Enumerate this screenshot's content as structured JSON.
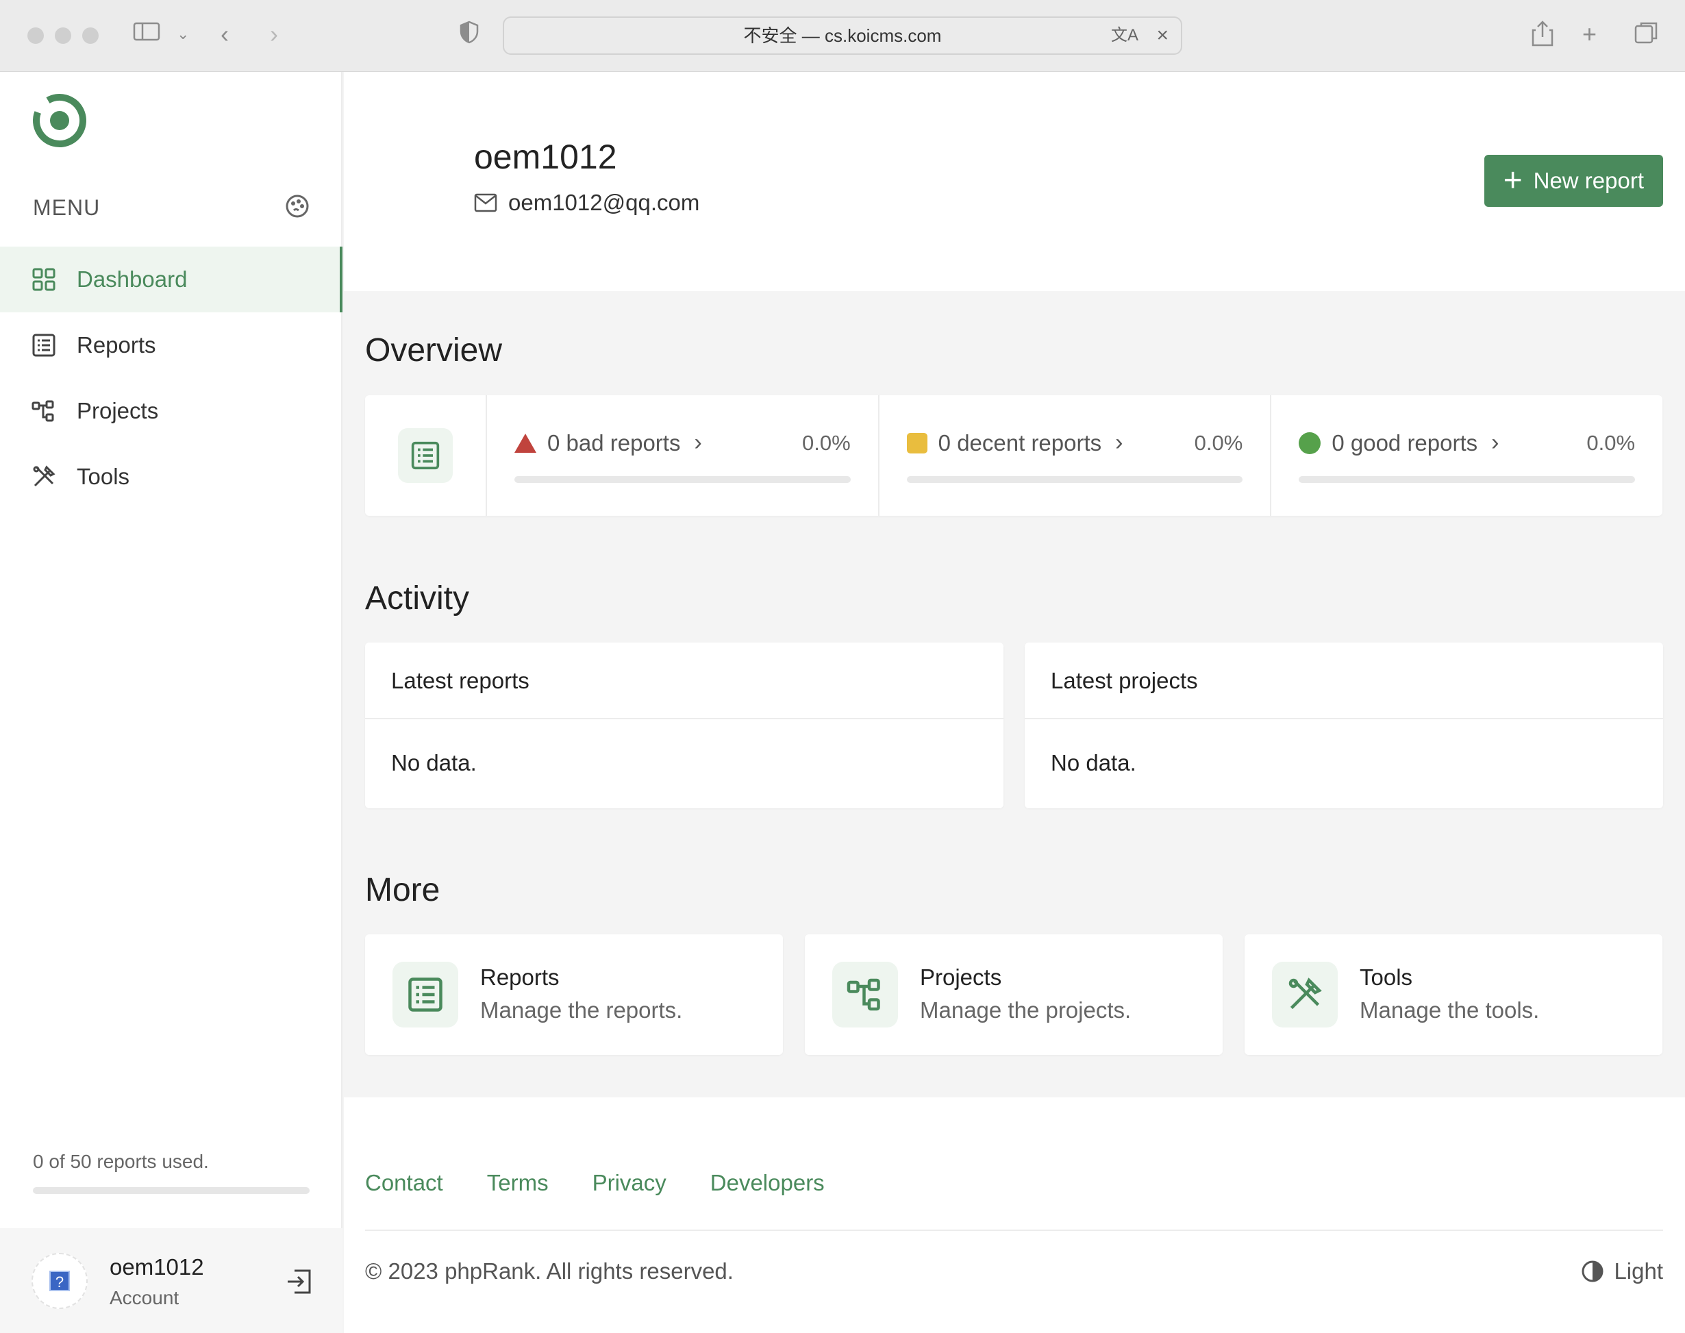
{
  "browser": {
    "address": "不安全 — cs.koicms.com"
  },
  "sidebar": {
    "menu_label": "MENU",
    "items": [
      {
        "label": "Dashboard",
        "icon": "dashboard-grid-icon"
      },
      {
        "label": "Reports",
        "icon": "list-icon"
      },
      {
        "label": "Projects",
        "icon": "projects-icon"
      },
      {
        "label": "Tools",
        "icon": "tools-icon"
      }
    ],
    "usage_text": "0 of 50 reports used.",
    "usage_fraction": 0,
    "account": {
      "name": "oem1012",
      "label": "Account"
    }
  },
  "header": {
    "username": "oem1012",
    "email": "oem1012@qq.com",
    "new_report_label": "New report"
  },
  "overview": {
    "title": "Overview",
    "stats": [
      {
        "label": "0 bad reports",
        "percent": "0.0%",
        "color": "#c0433d"
      },
      {
        "label": "0 decent reports",
        "percent": "0.0%",
        "color": "#e9bd3e"
      },
      {
        "label": "0 good reports",
        "percent": "0.0%",
        "color": "#56a14b"
      }
    ]
  },
  "activity": {
    "title": "Activity",
    "latest_reports": {
      "title": "Latest reports",
      "empty": "No data."
    },
    "latest_projects": {
      "title": "Latest projects",
      "empty": "No data."
    }
  },
  "more": {
    "title": "More",
    "cards": [
      {
        "title": "Reports",
        "desc": "Manage the reports."
      },
      {
        "title": "Projects",
        "desc": "Manage the projects."
      },
      {
        "title": "Tools",
        "desc": "Manage the tools."
      }
    ]
  },
  "footer": {
    "links": [
      "Contact",
      "Terms",
      "Privacy",
      "Developers"
    ],
    "copyright": "© 2023 phpRank. All rights reserved.",
    "theme_label": "Light"
  },
  "colors": {
    "accent": "#4a8a5c"
  }
}
